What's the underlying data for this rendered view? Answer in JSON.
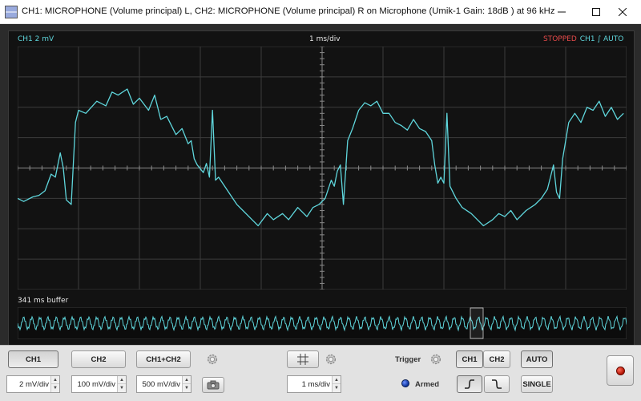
{
  "window": {
    "title": "CH1: MICROPHONE (Volume principal) L, CH2: MICROPHONE (Volume principal) R on Microphone (Umik-1  Gain: 18dB  ) at 96 kHz"
  },
  "scope": {
    "ch1_scale": "CH1 2 mV",
    "timebase": "1 ms/div",
    "status": "STOPPED",
    "trigger_info": "CH1 ∫ AUTO",
    "buffer_label": "341 ms buffer",
    "trace_color": "#5fd6dc",
    "grid_color": "#3c3c3c",
    "grid_divisions": {
      "x": 10,
      "y": 8
    }
  },
  "waveform": {
    "description_units": "divisions",
    "x_range": [
      0,
      10
    ],
    "y_range": [
      -4,
      4
    ],
    "points": [
      [
        0,
        -1
      ],
      [
        0.1,
        -1.1
      ],
      [
        0.25,
        -0.95
      ],
      [
        0.35,
        -0.9
      ],
      [
        0.45,
        -0.75
      ],
      [
        0.55,
        -0.2
      ],
      [
        0.62,
        -0.3
      ],
      [
        0.7,
        0.5
      ],
      [
        0.75,
        0
      ],
      [
        0.8,
        -1.05
      ],
      [
        0.88,
        -1.2
      ],
      [
        0.95,
        1.5
      ],
      [
        1.0,
        1.9
      ],
      [
        1.12,
        1.8
      ],
      [
        1.3,
        2.2
      ],
      [
        1.45,
        2.05
      ],
      [
        1.55,
        2.5
      ],
      [
        1.65,
        2.4
      ],
      [
        1.8,
        2.6
      ],
      [
        1.9,
        2.1
      ],
      [
        2.0,
        2.3
      ],
      [
        2.15,
        1.9
      ],
      [
        2.25,
        2.4
      ],
      [
        2.35,
        1.6
      ],
      [
        2.45,
        1.7
      ],
      [
        2.6,
        1.1
      ],
      [
        2.7,
        1.3
      ],
      [
        2.8,
        0.8
      ],
      [
        2.85,
        0.9
      ],
      [
        2.9,
        0.3
      ],
      [
        2.95,
        0.1
      ],
      [
        3.05,
        -0.15
      ],
      [
        3.1,
        0.15
      ],
      [
        3.15,
        -0.3
      ],
      [
        3.2,
        1.9
      ],
      [
        3.25,
        -0.4
      ],
      [
        3.3,
        -0.3
      ],
      [
        3.4,
        -0.6
      ],
      [
        3.5,
        -0.9
      ],
      [
        3.6,
        -1.2
      ],
      [
        3.7,
        -1.4
      ],
      [
        3.85,
        -1.7
      ],
      [
        3.95,
        -1.9
      ],
      [
        4.1,
        -1.5
      ],
      [
        4.2,
        -1.7
      ],
      [
        4.35,
        -1.5
      ],
      [
        4.45,
        -1.7
      ],
      [
        4.6,
        -1.3
      ],
      [
        4.75,
        -1.6
      ],
      [
        4.85,
        -1.3
      ],
      [
        4.95,
        -1.2
      ],
      [
        5.05,
        -1.0
      ],
      [
        5.15,
        -0.4
      ],
      [
        5.2,
        -0.6
      ],
      [
        5.25,
        -0.1
      ],
      [
        5.3,
        0.1
      ],
      [
        5.35,
        -1.2
      ],
      [
        5.42,
        0.9
      ],
      [
        5.5,
        1.3
      ],
      [
        5.6,
        1.9
      ],
      [
        5.7,
        2.15
      ],
      [
        5.8,
        2.05
      ],
      [
        5.9,
        2.2
      ],
      [
        6.0,
        1.8
      ],
      [
        6.1,
        1.8
      ],
      [
        6.2,
        1.5
      ],
      [
        6.3,
        1.4
      ],
      [
        6.4,
        1.25
      ],
      [
        6.5,
        1.6
      ],
      [
        6.6,
        1.3
      ],
      [
        6.7,
        1.2
      ],
      [
        6.8,
        0.9
      ],
      [
        6.85,
        0.1
      ],
      [
        6.9,
        -0.5
      ],
      [
        6.95,
        -0.3
      ],
      [
        7.0,
        -0.5
      ],
      [
        7.05,
        1.8
      ],
      [
        7.1,
        -0.6
      ],
      [
        7.2,
        -1.0
      ],
      [
        7.3,
        -1.3
      ],
      [
        7.45,
        -1.5
      ],
      [
        7.55,
        -1.7
      ],
      [
        7.65,
        -1.9
      ],
      [
        7.8,
        -1.7
      ],
      [
        7.9,
        -1.5
      ],
      [
        8.0,
        -1.6
      ],
      [
        8.1,
        -1.4
      ],
      [
        8.2,
        -1.7
      ],
      [
        8.35,
        -1.4
      ],
      [
        8.5,
        -1.2
      ],
      [
        8.6,
        -1.0
      ],
      [
        8.7,
        -0.7
      ],
      [
        8.75,
        -0.3
      ],
      [
        8.8,
        0.1
      ],
      [
        8.85,
        -0.8
      ],
      [
        8.9,
        -1.0
      ],
      [
        8.95,
        0.3
      ],
      [
        9.0,
        0.9
      ],
      [
        9.05,
        1.5
      ],
      [
        9.15,
        1.8
      ],
      [
        9.25,
        1.5
      ],
      [
        9.35,
        2.0
      ],
      [
        9.45,
        1.9
      ],
      [
        9.55,
        2.2
      ],
      [
        9.65,
        1.7
      ],
      [
        9.75,
        2.0
      ],
      [
        9.85,
        1.6
      ],
      [
        9.95,
        1.8
      ]
    ]
  },
  "buttons": {
    "ch1": "CH1",
    "ch2": "CH2",
    "ch1ch2": "CH1+CH2",
    "trig_ch1": "CH1",
    "trig_ch2": "CH2",
    "auto": "AUTO",
    "single": "SINGLE"
  },
  "spinners": {
    "ch1_scale": "2 mV/div",
    "ch2_scale": "100 mV/div",
    "ch1ch2_scale": "500 mV/div",
    "timebase": "1 ms/div"
  },
  "labels": {
    "trigger": "Trigger",
    "armed": "Armed"
  },
  "colors": {
    "trace": "#5fd6dc",
    "stopped": "#e64a4a",
    "panel_bg": "#121212",
    "armed_led": "#1a4fd6",
    "record_dot": "#d21f10"
  }
}
